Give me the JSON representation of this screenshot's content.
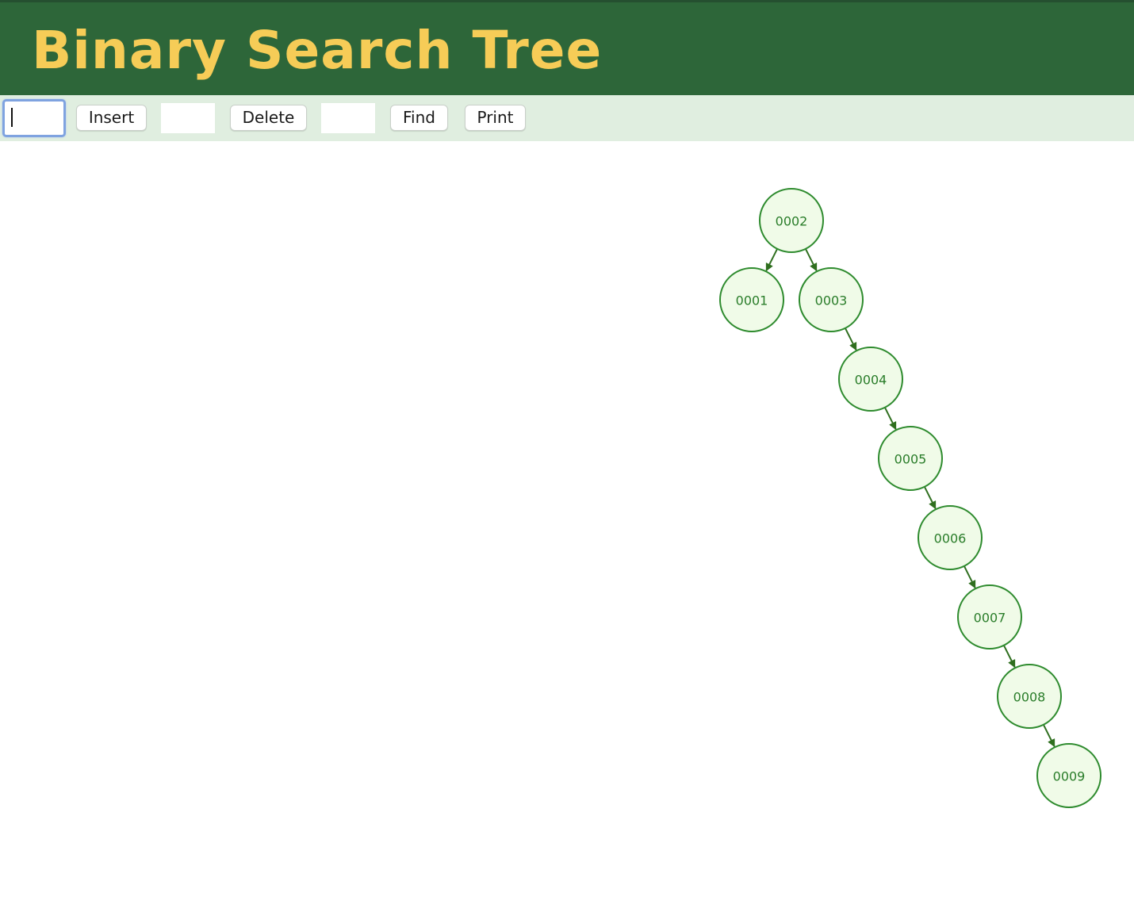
{
  "header": {
    "title": "Binary Search Tree"
  },
  "toolbar": {
    "insert_input_value": "",
    "insert_label": "Insert",
    "delete_input_value": "",
    "delete_label": "Delete",
    "find_input_value": "",
    "find_label": "Find",
    "print_label": "Print"
  },
  "tree": {
    "node_fill": "#f0fbe8",
    "node_stroke": "#2e8b2e",
    "edge_color": "#2f6f1f",
    "nodes": [
      {
        "id": "n2",
        "label": "0002"
      },
      {
        "id": "n1",
        "label": "0001"
      },
      {
        "id": "n3",
        "label": "0003"
      },
      {
        "id": "n4",
        "label": "0004"
      },
      {
        "id": "n5",
        "label": "0005"
      },
      {
        "id": "n6",
        "label": "0006"
      },
      {
        "id": "n7",
        "label": "0007"
      },
      {
        "id": "n8",
        "label": "0008"
      },
      {
        "id": "n9",
        "label": "0009"
      }
    ],
    "edges": [
      {
        "from": "n2",
        "to": "n1"
      },
      {
        "from": "n2",
        "to": "n3"
      },
      {
        "from": "n3",
        "to": "n4"
      },
      {
        "from": "n4",
        "to": "n5"
      },
      {
        "from": "n5",
        "to": "n6"
      },
      {
        "from": "n6",
        "to": "n7"
      },
      {
        "from": "n7",
        "to": "n8"
      },
      {
        "from": "n8",
        "to": "n9"
      }
    ]
  }
}
